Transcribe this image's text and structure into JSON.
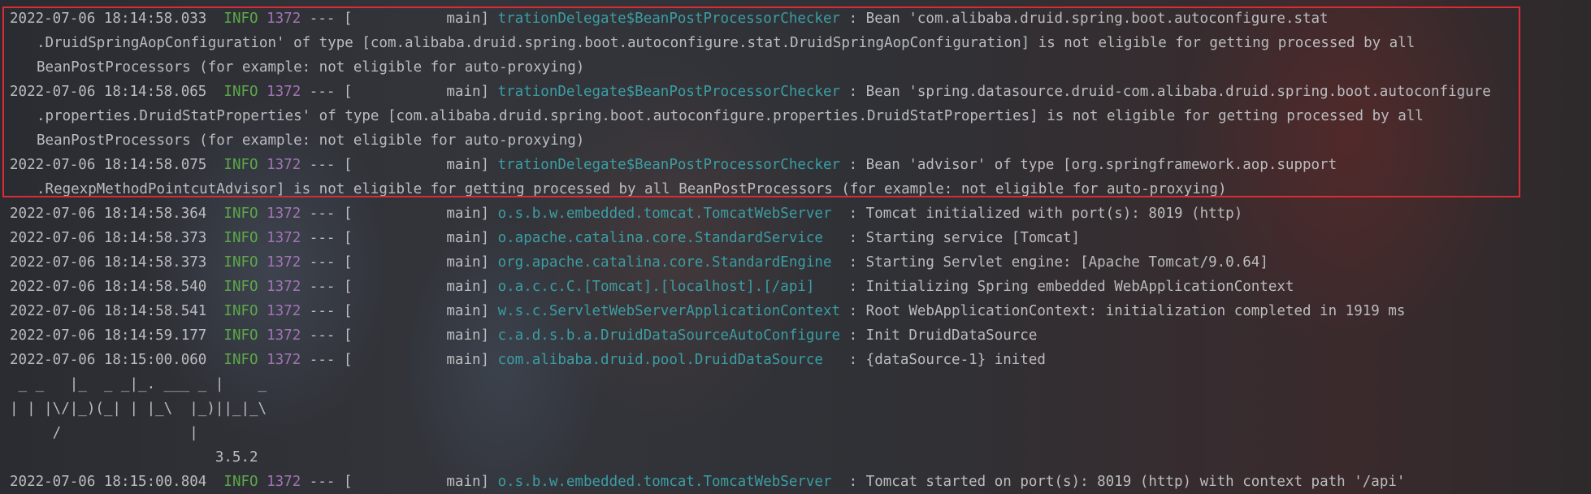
{
  "console": {
    "entries": [
      {
        "ts": "2022-07-06 18:14:58.033",
        "level": "INFO",
        "pid": "1372",
        "sep": " --- [",
        "thread": "           main] ",
        "logger": "trationDelegate$BeanPostProcessorChecker",
        "pad": " : ",
        "msg": "Bean 'com.alibaba.druid.spring.boot.autoconfigure.stat",
        "cont": [
          ".DruidSpringAopConfiguration' of type [com.alibaba.druid.spring.boot.autoconfigure.stat.DruidSpringAopConfiguration] is not eligible for getting processed by all",
          "BeanPostProcessors (for example: not eligible for auto-proxying)"
        ]
      },
      {
        "ts": "2022-07-06 18:14:58.065",
        "level": "INFO",
        "pid": "1372",
        "sep": " --- [",
        "thread": "           main] ",
        "logger": "trationDelegate$BeanPostProcessorChecker",
        "pad": " : ",
        "msg": "Bean 'spring.datasource.druid-com.alibaba.druid.spring.boot.autoconfigure",
        "cont": [
          ".properties.DruidStatProperties' of type [com.alibaba.druid.spring.boot.autoconfigure.properties.DruidStatProperties] is not eligible for getting processed by all",
          "BeanPostProcessors (for example: not eligible for auto-proxying)"
        ]
      },
      {
        "ts": "2022-07-06 18:14:58.075",
        "level": "INFO",
        "pid": "1372",
        "sep": " --- [",
        "thread": "           main] ",
        "logger": "trationDelegate$BeanPostProcessorChecker",
        "pad": " : ",
        "msg": "Bean 'advisor' of type [org.springframework.aop.support",
        "cont": [
          ".RegexpMethodPointcutAdvisor] is not eligible for getting processed by all BeanPostProcessors (for example: not eligible for auto-proxying)"
        ]
      },
      {
        "ts": "2022-07-06 18:14:58.364",
        "level": "INFO",
        "pid": "1372",
        "sep": " --- [",
        "thread": "           main] ",
        "logger": "o.s.b.w.embedded.tomcat.TomcatWebServer",
        "pad": "  : ",
        "msg": "Tomcat initialized with port(s): 8019 (http)",
        "cont": []
      },
      {
        "ts": "2022-07-06 18:14:58.373",
        "level": "INFO",
        "pid": "1372",
        "sep": " --- [",
        "thread": "           main] ",
        "logger": "o.apache.catalina.core.StandardService",
        "pad": "   : ",
        "msg": "Starting service [Tomcat]",
        "cont": []
      },
      {
        "ts": "2022-07-06 18:14:58.373",
        "level": "INFO",
        "pid": "1372",
        "sep": " --- [",
        "thread": "           main] ",
        "logger": "org.apache.catalina.core.StandardEngine",
        "pad": "  : ",
        "msg": "Starting Servlet engine: [Apache Tomcat/9.0.64]",
        "cont": []
      },
      {
        "ts": "2022-07-06 18:14:58.540",
        "level": "INFO",
        "pid": "1372",
        "sep": " --- [",
        "thread": "           main] ",
        "logger": "o.a.c.c.C.[Tomcat].[localhost].[/api]",
        "pad": "    : ",
        "msg": "Initializing Spring embedded WebApplicationContext",
        "cont": []
      },
      {
        "ts": "2022-07-06 18:14:58.541",
        "level": "INFO",
        "pid": "1372",
        "sep": " --- [",
        "thread": "           main] ",
        "logger": "w.s.c.ServletWebServerApplicationContext",
        "pad": " : ",
        "msg": "Root WebApplicationContext: initialization completed in 1919 ms",
        "cont": []
      },
      {
        "ts": "2022-07-06 18:14:59.177",
        "level": "INFO",
        "pid": "1372",
        "sep": " --- [",
        "thread": "           main] ",
        "logger": "c.a.d.s.b.a.DruidDataSourceAutoConfigure",
        "pad": " : ",
        "msg": "Init DruidDataSource",
        "cont": []
      },
      {
        "ts": "2022-07-06 18:15:00.060",
        "level": "INFO",
        "pid": "1372",
        "sep": " --- [",
        "thread": "           main] ",
        "logger": "com.alibaba.druid.pool.DruidDataSource",
        "pad": "   : ",
        "msg": "{dataSource-1} inited",
        "cont": []
      }
    ],
    "banner": [
      " _ _   |_  _ _|_. ___ _ |    _",
      "| | |\\/|_)(_| | |_\\  |_)||_|_\\",
      "     /               |",
      "                        3.5.2"
    ],
    "final_entry": {
      "ts": "2022-07-06 18:15:00.804",
      "level": "INFO",
      "pid": "1372",
      "sep": " --- [",
      "thread": "           main] ",
      "logger": "o.s.b.w.embedded.tomcat.TomcatWebServer",
      "pad": "  : ",
      "msg": "Tomcat started on port(s): 8019 (http) with context path '/api'"
    },
    "highlight_color": "#d92c36",
    "colors": {
      "level": "#5da84a",
      "pid": "#a374b5",
      "logger": "#3a9ea3",
      "text": "#bbbcbf"
    }
  }
}
